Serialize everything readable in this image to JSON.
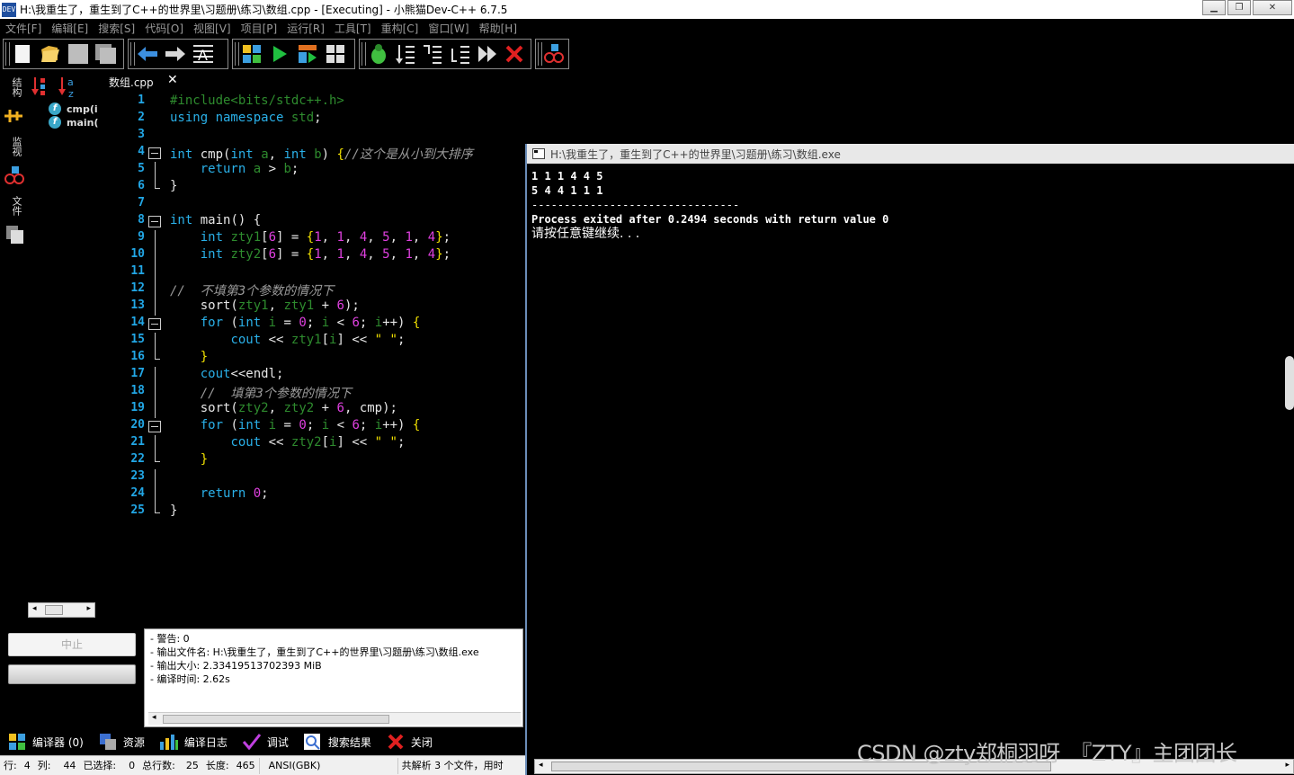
{
  "window": {
    "title": "H:\\我重生了，重生到了C++的世界里\\习题册\\练习\\数组.cpp - [Executing] - 小熊猫Dev-C++ 6.7.5",
    "app_icon": "DEV"
  },
  "menu": [
    "文件[F]",
    "编辑[E]",
    "搜索[S]",
    "代码[O]",
    "视图[V]",
    "项目[P]",
    "运行[R]",
    "工具[T]",
    "重构[C]",
    "窗口[W]",
    "帮助[H]"
  ],
  "toolbar": {
    "groups": [
      [
        "new-file-icon",
        "open-folder-icon",
        "save-icon",
        "save-all-icon"
      ],
      [
        "back-arrow-icon",
        "forward-arrow-icon",
        "format-code-icon"
      ],
      [
        "compile-icon",
        "run-icon",
        "compile-run-icon",
        "rebuild-icon"
      ],
      [
        "debug-bug-icon",
        "step-over-icon",
        "step-into-icon",
        "step-out-icon",
        "continue-icon",
        "stop-debug-icon"
      ],
      [
        "add-watch-icon"
      ]
    ]
  },
  "side_tabs": [
    "结构",
    "监视",
    "文件"
  ],
  "class_browser": {
    "items": [
      "cmp(i",
      "main("
    ]
  },
  "editor": {
    "tab_label": "数组.cpp",
    "tab_close": "✕"
  },
  "code_lines": [
    "1",
    "2",
    "3",
    "4",
    "5",
    "6",
    "7",
    "8",
    "9",
    "10",
    "11",
    "12",
    "13",
    "14",
    "15",
    "16",
    "17",
    "18",
    "19",
    "20",
    "21",
    "22",
    "23",
    "24",
    "25"
  ],
  "console": {
    "title": "H:\\我重生了，重生到了C++的世界里\\习题册\\练习\\数组.exe",
    "lines": [
      "1 1 1 4 4 5",
      "5 4 4 1 1 1",
      "--------------------------------",
      "Process exited after 0.2494 seconds with return value 0",
      "请按任意键继续. . ."
    ]
  },
  "stop_button": "中止",
  "log_lines": [
    "- 警告: 0",
    "- 输出文件名: H:\\我重生了，重生到了C++的世界里\\习题册\\练习\\数组.exe",
    "- 输出大小: 2.33419513702393 MiB",
    "- 编译时间: 2.62s"
  ],
  "bottom_tabs": [
    {
      "label": "编译器 (0)",
      "icon": "compiler-icon"
    },
    {
      "label": "资源",
      "icon": "resource-icon"
    },
    {
      "label": "编译日志",
      "icon": "compile-log-icon"
    },
    {
      "label": "调试",
      "icon": "debug-check-icon"
    },
    {
      "label": "搜索结果",
      "icon": "search-results-icon"
    },
    {
      "label": "关闭",
      "icon": "close-panel-icon"
    }
  ],
  "status": {
    "line": "行:",
    "line_val": "4",
    "col": "列:",
    "col_val": "44",
    "sel": "已选择:",
    "sel_val": "0",
    "total": "总行数:",
    "total_val": "25",
    "length": "长度:",
    "length_val": "465",
    "encoding": "ANSI(GBK)",
    "parse": "共解析 3 个文件，用时"
  },
  "watermark": "CSDN @zty郑桐羽呀　『ZTY』主团团长"
}
